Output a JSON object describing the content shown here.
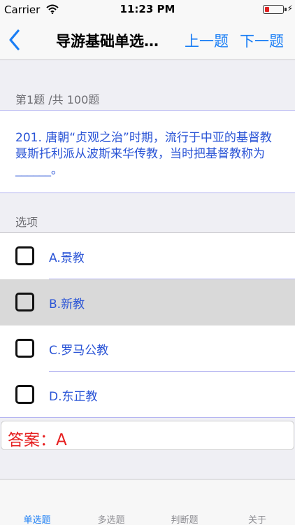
{
  "status_bar": {
    "carrier": "Carrier",
    "time": "11:23 PM",
    "wifi_icon": "wifi-icon",
    "battery_level": 0.2
  },
  "nav": {
    "back_icon": "chevron-left-icon",
    "title": "导游基础单选…",
    "prev_label": "上一题",
    "next_label": "下一题"
  },
  "question": {
    "counter": "第1题 /共 100题",
    "text": "201. 唐朝“贞观之治”时期，流行于中亚的基督教聂斯托利派从波斯来华传教，当时把基督教称为______。"
  },
  "options": {
    "header": "选项",
    "items": [
      {
        "label": "A.景教",
        "selected": false
      },
      {
        "label": "B.新教",
        "selected": true
      },
      {
        "label": "C.罗马公教",
        "selected": false
      },
      {
        "label": "D.东正教",
        "selected": false
      }
    ]
  },
  "answer": {
    "text": "答案：A"
  },
  "tabs": [
    {
      "label": "单选题",
      "active": true
    },
    {
      "label": "多选题",
      "active": false
    },
    {
      "label": "判断题",
      "active": false
    },
    {
      "label": "关于",
      "active": false
    }
  ],
  "colors": {
    "accent": "#1a7ef5",
    "question_text": "#2a54d6",
    "answer_text": "#e62020",
    "selected_row": "#d9d9d9"
  }
}
